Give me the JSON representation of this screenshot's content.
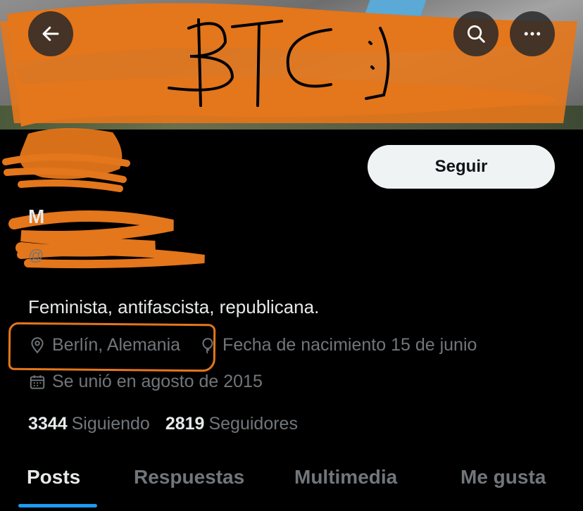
{
  "header": {
    "back_icon": "arrow-left-icon",
    "search_icon": "search-icon",
    "more_icon": "more-horizontal-icon",
    "banner_scribble_text": "BTC :)"
  },
  "profile": {
    "follow_label": "Seguir",
    "name": "M",
    "handle": "@",
    "bio": "Feminista, antifascista, republicana.",
    "location": "Berlín, Alemania",
    "birthday": "Fecha de nacimiento 15 de junio",
    "joined": "Se unió en agosto de 2015"
  },
  "stats": {
    "following_count": "3344",
    "following_label": "Siguiendo",
    "followers_count": "2819",
    "followers_label": "Seguidores"
  },
  "tabs": [
    {
      "label": "Posts",
      "active": true
    },
    {
      "label": "Respuestas",
      "active": false
    },
    {
      "label": "Multimedia",
      "active": false
    },
    {
      "label": "Me gusta",
      "active": false
    }
  ],
  "colors": {
    "accent": "#1d9bf0",
    "scribble": "#e4761b",
    "background": "#000000",
    "secondary_text": "#71767b"
  }
}
